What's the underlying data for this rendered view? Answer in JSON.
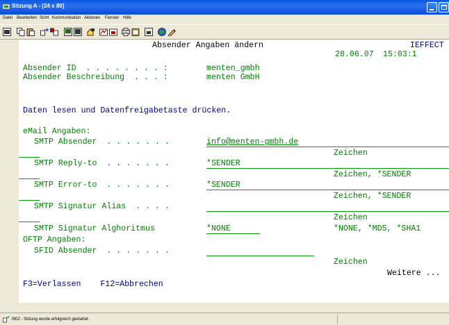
{
  "window": {
    "title": "Sitzung A - [24 x 80]"
  },
  "menu": [
    "Datei",
    "Bearbeiten",
    "Sicht",
    "Kommunikation",
    "Aktionen",
    "Fenster",
    "Hilfe"
  ],
  "toolbar_icons": [
    "screen-icon",
    "copy-icon",
    "paste-icon",
    "send-icon",
    "receive-icon",
    "display-icon",
    "record-icon",
    "macro-play-icon",
    "macro-stop-icon",
    "print-icon",
    "print-screen-icon",
    "clipboard-icon",
    "color-icon",
    "edit-icon"
  ],
  "terminal": {
    "screen_title": "Absender Angaben ändern",
    "program_id": "IEFFECT",
    "date": "28.06.07",
    "time": "15:03:1",
    "fields": {
      "absender_id_label": "Absender ID  . . . . . . . . :",
      "absender_id_value": "menten_gmbh",
      "absender_beschreibung_label": "Absender Beschreibung  . . . :",
      "absender_beschreibung_value": "menten GmbH"
    },
    "instruction": "Daten lesen und Datenfreigabetaste drücken.",
    "email_section": "eMail Angaben:",
    "smtp_absender_label": "SMTP Absender  . . . . . . .",
    "smtp_absender_value": "info@menten-gmbh.de",
    "hint_zeichen_1": "Zeichen",
    "smtp_replyto_label": "SMTP Reply-to  . . . . . . .",
    "smtp_replyto_value": "*SENDER",
    "hint_zeichen_sender_1": "Zeichen, *SENDER",
    "smtp_errorto_label": "SMTP Error-to  . . . . . . .",
    "smtp_errorto_value": "*SENDER",
    "hint_zeichen_sender_2": "Zeichen, *SENDER",
    "smtp_signatur_alias_label": "SMTP Signatur Alias  . . . .",
    "smtp_signatur_alias_value": "",
    "hint_zeichen_2": "Zeichen",
    "smtp_signatur_algo_label": "SMTP Signatur Alghoritmus",
    "smtp_signatur_algo_value": "*NONE",
    "hint_algo_options": "*NONE, *MD5, *SHA1",
    "oftp_section": "OFTP Angaben:",
    "sfid_absender_label": "SFID Absender  . . . . . . .",
    "sfid_absender_value": "",
    "hint_zeichen_3": "Zeichen",
    "weitere": "Weitere ...",
    "function_keys": "F3=Verlassen    F12=Abbrechen"
  },
  "status": {
    "text": "I902 - Sitzung wurde erfolgreich gestartet."
  }
}
